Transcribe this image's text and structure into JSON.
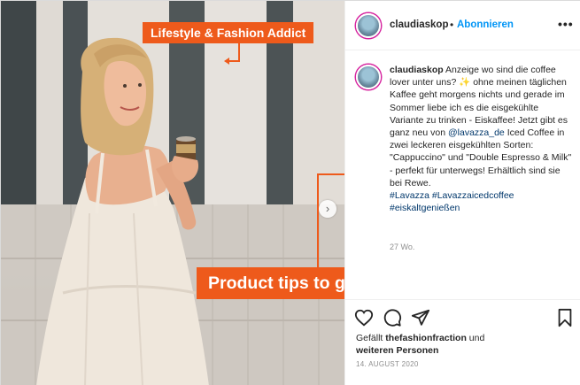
{
  "post": {
    "username": "claudiaskop",
    "separator": "•",
    "follow_label": "Abonnieren",
    "more_label": "•••",
    "caption_intro": "Anzeige wo sind die coffee lover unter uns?",
    "caption_emoji": "✨",
    "caption_body_1": "ohne meinen täglichen Kaffee geht morgens nichts und gerade im Sommer liebe ich es die eisgekühlte Variante zu trinken - Eiskaffee! Jetzt gibt es ganz neu von",
    "caption_mention": "@lavazza_de",
    "caption_body_2": "Iced Coffee in zwei leckeren eisgekühlten Sorten: \"Cappuccino\" und \"Double Espresso & Milk\" - perfekt für unterwegs! Erhältlich sind sie bei Rewe.",
    "caption_tag_1": "#Lavazza",
    "caption_tag_2": "#Lavazzaicedcoffee",
    "caption_tag_3": "#eiskaltgenießen",
    "time_ago": "27 Wo.",
    "likes_prefix": "Gefällt",
    "likes_user": "thefashionfraction",
    "likes_and": "und",
    "likes_others": "weiteren Personen",
    "date": "14. AUGUST 2020"
  },
  "annotations": {
    "top_label": "Lifestyle & Fashion Addict",
    "bottom_label": "Product tips to guide her followers",
    "accent_color": "#ee5a1b"
  },
  "icons": {
    "next": "›",
    "heart": "heart-icon",
    "comment": "comment-icon",
    "share": "share-icon",
    "save": "bookmark-icon"
  }
}
